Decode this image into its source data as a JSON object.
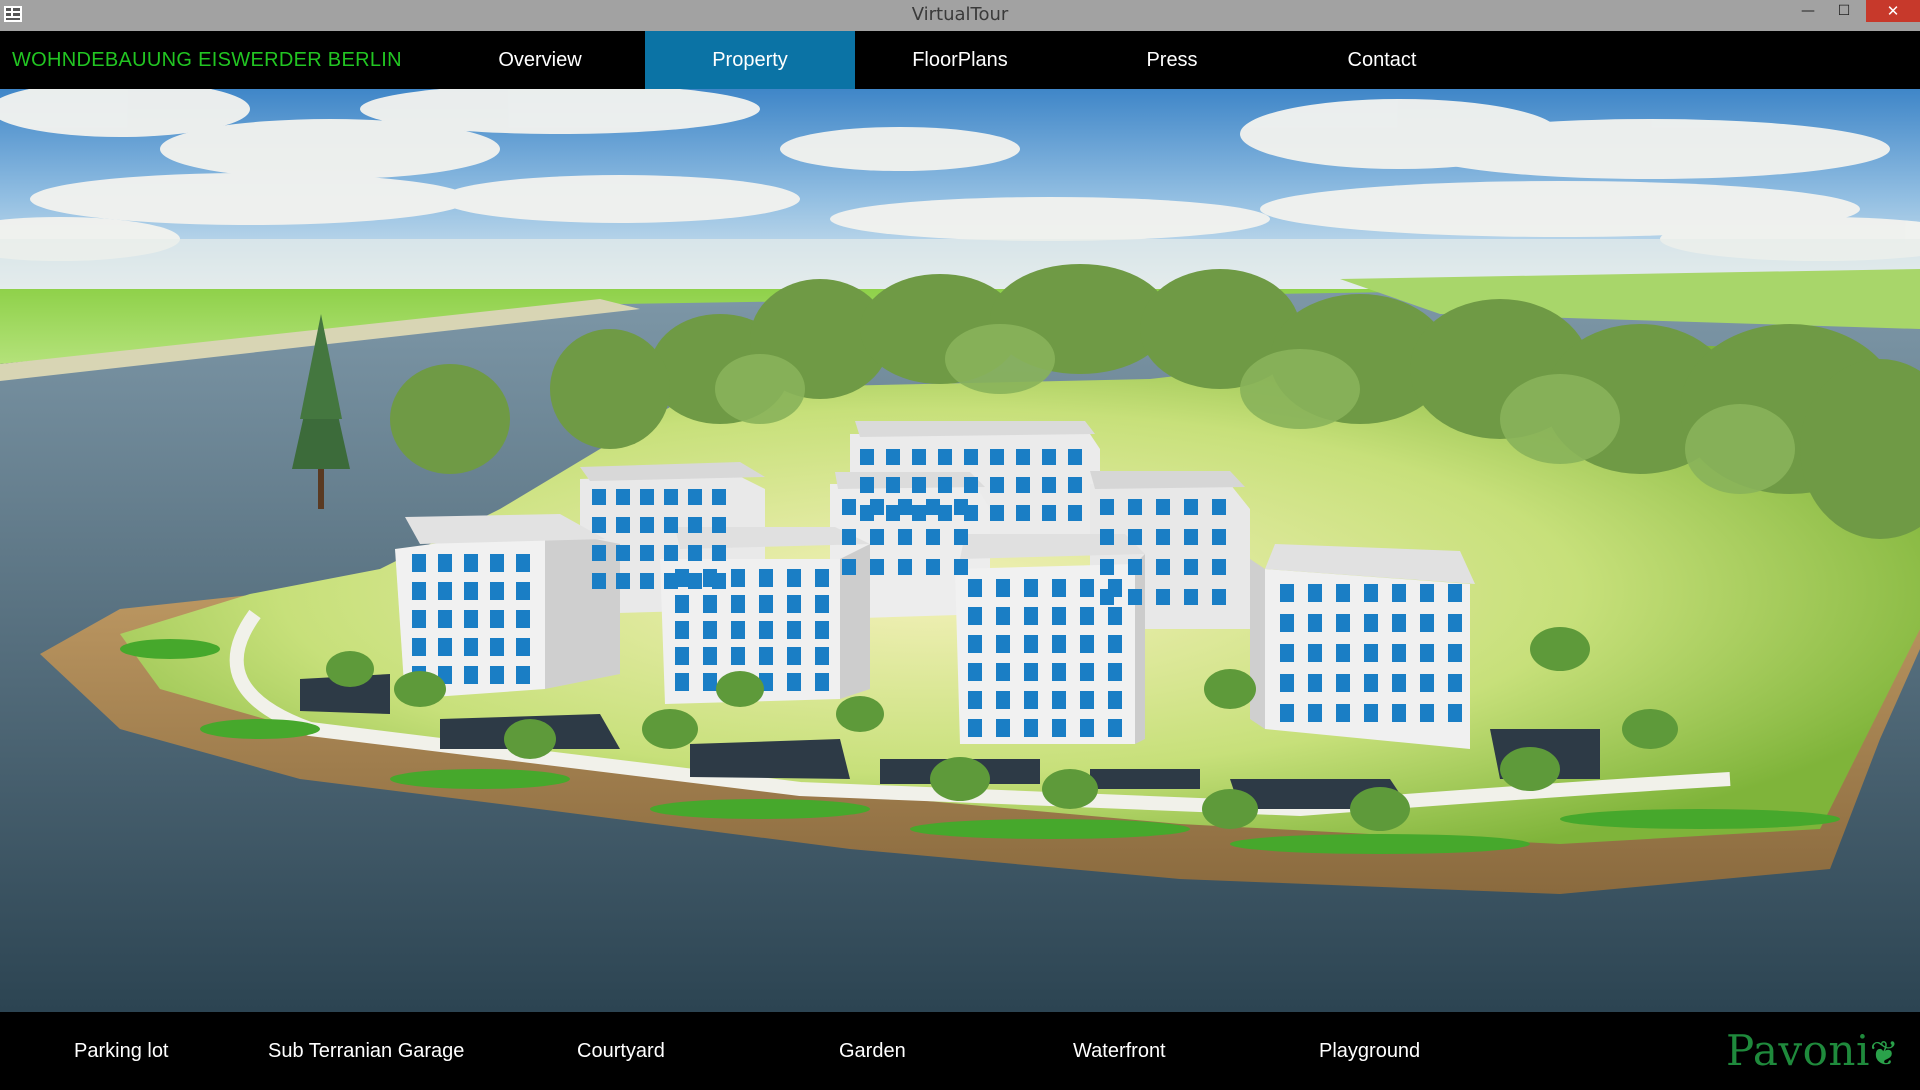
{
  "window": {
    "title": "VirtualTour",
    "controls": {
      "minimize": "—",
      "maximize": "☐",
      "close": "✕"
    }
  },
  "header": {
    "brand": "WOHNDEBAUUNG EISWERDER BERLIN",
    "tabs": [
      {
        "label": "Overview",
        "active": false
      },
      {
        "label": "Property",
        "active": true
      },
      {
        "label": "FloorPlans",
        "active": false
      },
      {
        "label": "Press",
        "active": false
      },
      {
        "label": "Contact",
        "active": false
      }
    ]
  },
  "footer": {
    "items": [
      {
        "label": "Parking lot"
      },
      {
        "label": "Sub Terranian Garage"
      },
      {
        "label": "Courtyard"
      },
      {
        "label": "Garden"
      },
      {
        "label": "Waterfront"
      },
      {
        "label": "Playground"
      }
    ],
    "logo": "Pavoni"
  },
  "colors": {
    "brand_green": "#22c522",
    "active_tab": "#0b73a5",
    "window_close": "#c7392b",
    "logo_green": "#1f8a3c"
  },
  "icons": {
    "app": "grid-window-icon",
    "logo_mark": "leaf-icon"
  }
}
